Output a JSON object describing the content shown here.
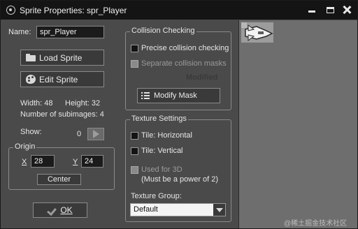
{
  "window": {
    "title": "Sprite Properties: spr_Player"
  },
  "name": {
    "label": "Name:",
    "value": "spr_Player"
  },
  "buttons": {
    "load_sprite": "Load Sprite",
    "edit_sprite": "Edit Sprite",
    "modify_mask": "Modify Mask",
    "center": "Center",
    "ok": "OK"
  },
  "info": {
    "width": "Width: 48",
    "height": "Height: 32",
    "subimages": "Number of subimages: 4",
    "show_label": "Show:",
    "show_value": "0"
  },
  "origin": {
    "title": "Origin",
    "x_label": "X",
    "x_value": "28",
    "y_label": "Y",
    "y_value": "24"
  },
  "collision": {
    "title": "Collision Checking",
    "precise": "Precise collision checking",
    "separate": "Separate collision masks",
    "modified": "Modified"
  },
  "texture": {
    "title": "Texture Settings",
    "tile_horizontal": "Tile: Horizontal",
    "tile_vertical": "Tile: Vertical",
    "used_3d": "Used for 3D",
    "power2": "(Must be a power of 2)",
    "group_label": "Texture Group:",
    "group_value": "Default"
  },
  "watermark": "@稀土掘金技术社区",
  "colors": {
    "window_bg": "#4a4a4a",
    "titlebar_bg": "#141414",
    "preview_bg": "#6e6e6e"
  }
}
